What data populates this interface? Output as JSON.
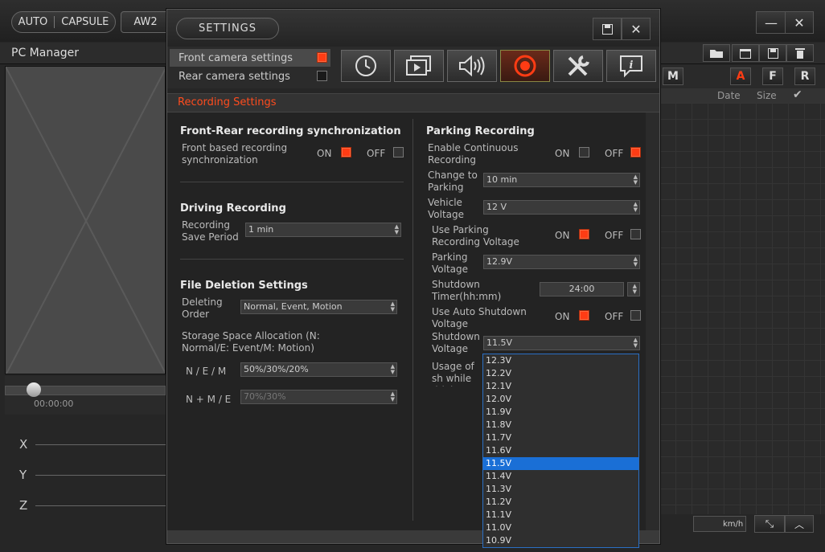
{
  "topbar": {
    "auto_label": "AUTO",
    "capsule_label": "CAPSULE",
    "aw2_label": "AW2",
    "minimize": "—",
    "close": "✕"
  },
  "pc_manager": {
    "title": "PC Manager"
  },
  "player": {
    "time": "00:00:00",
    "axes": [
      "X",
      "Y",
      "Z"
    ],
    "speed_unit": "km/h"
  },
  "file_panel": {
    "filters": [
      "M",
      "A",
      "F",
      "R"
    ],
    "columns": {
      "date": "Date",
      "size": "Size"
    }
  },
  "dialog": {
    "title": "SETTINGS",
    "camera_tabs": [
      {
        "label": "Front camera settings",
        "selected": true
      },
      {
        "label": "Rear camera settings",
        "selected": false
      }
    ],
    "tool_tabs": [
      "clock-icon",
      "playback-icon",
      "speaker-icon",
      "record-icon",
      "tools-icon",
      "info-icon"
    ],
    "section_title": "Recording Settings",
    "sync": {
      "heading": "Front-Rear recording synchronization",
      "label": "Front based recording synchronization",
      "on": "ON",
      "off": "OFF"
    },
    "driving": {
      "heading": "Driving Recording",
      "save_period_label": "Recording Save Period",
      "save_period_value": "1 min"
    },
    "deletion": {
      "heading": "File Deletion Settings",
      "order_label": "Deleting Order",
      "order_value": "Normal, Event, Motion",
      "storage_label": "Storage Space Allocation (N: Normal/E: Event/M: Motion)",
      "nem_label": "N / E / M",
      "nem_value": "50%/30%/20%",
      "nme_label": "N + M / E",
      "nme_value": "70%/30%"
    },
    "parking": {
      "heading": "Parking Recording",
      "continuous_label": "Enable Continuous Recording",
      "change_label": "Change to Parking",
      "change_value": "10 min",
      "vehicle_label": "Vehicle Voltage",
      "vehicle_value": "12 V",
      "use_parking_voltage_label": "Use Parking Recording Voltage",
      "parking_voltage_label": "Parking Voltage",
      "parking_voltage_value": "12.9V",
      "shutdown_timer_label": "Shutdown Timer(hh:mm)",
      "shutdown_timer_value": "24:00",
      "auto_shutdown_label": "Use Auto Shutdown Voltage",
      "shutdown_voltage_label": "Shutdown Voltage",
      "shutdown_voltage_value": "11.5V",
      "usage_label": "Usage of sh while driving",
      "on": "ON",
      "off": "OFF"
    },
    "dropdown_options": [
      "12.3V",
      "12.2V",
      "12.1V",
      "12.0V",
      "11.9V",
      "11.8V",
      "11.7V",
      "11.6V",
      "11.5V",
      "11.4V",
      "11.3V",
      "11.2V",
      "11.1V",
      "11.0V",
      "10.9V"
    ],
    "dropdown_selected": "11.5V"
  },
  "colors": {
    "accent": "#ff3c14",
    "selection": "#1a6fd6"
  }
}
